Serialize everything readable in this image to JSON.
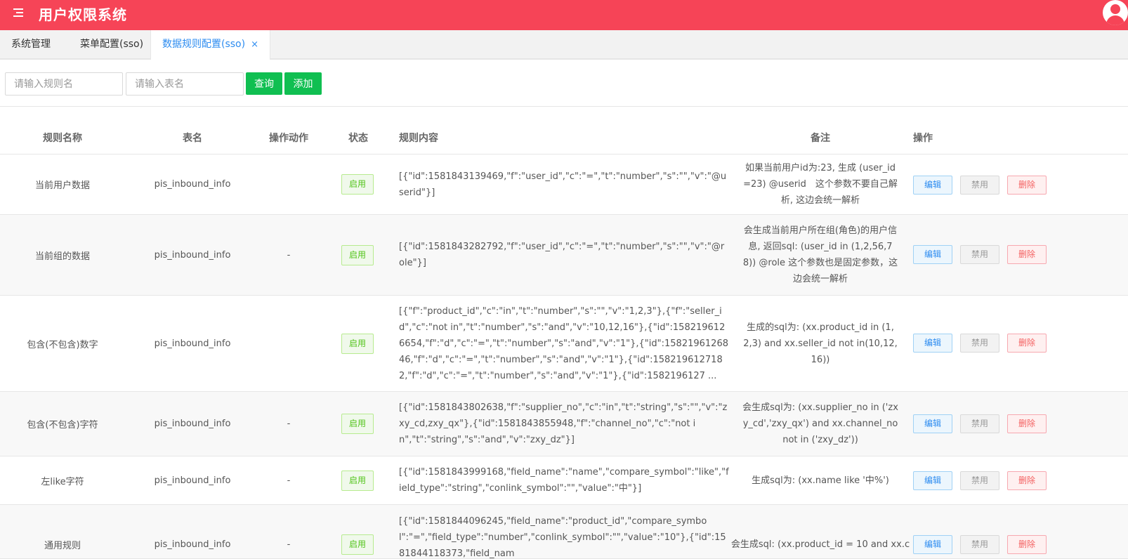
{
  "header": {
    "title": "用户权限系统"
  },
  "tabs": [
    {
      "label": "系统管理"
    },
    {
      "label": "菜单配置(sso)"
    },
    {
      "label": "数据规则配置(sso)",
      "close": "×"
    }
  ],
  "search": {
    "rule_placeholder": "请输入规则名",
    "table_placeholder": "请输入表名",
    "query_label": "查询",
    "add_label": "添加"
  },
  "table": {
    "headers": [
      "规则名称",
      "表名",
      "操作动作",
      "状态",
      "规则内容",
      "备注",
      "操作"
    ],
    "actions": {
      "edit": "编辑",
      "disable": "禁用",
      "delete": "删除"
    },
    "rows": [
      {
        "name": "当前用户数据",
        "table": "pis_inbound_info",
        "action": "",
        "status": "启用",
        "content": "[{\"id\":1581843139469,\"f\":\"user_id\",\"c\":\"=\",\"t\":\"number\",\"s\":\"\",\"v\":\"@userid\"}]",
        "remark": "如果当前用户id为:23, 生成 (user_id=23) @userid　这个参数不要自己解析, 这边会统一解析"
      },
      {
        "name": "当前组的数据",
        "table": "pis_inbound_info",
        "action": "-",
        "status": "启用",
        "content": "[{\"id\":1581843282792,\"f\":\"user_id\",\"c\":\"=\",\"t\":\"number\",\"s\":\"\",\"v\":\"@role\"}]",
        "remark": "会生成当前用户所在组(角色)的用户信息, 返回sql: (user_id in (1,2,56,78)) @role 这个参数也是固定参数，这边会统一解析"
      },
      {
        "name": "包含(不包含)数字",
        "table": "pis_inbound_info",
        "action": "",
        "status": "启用",
        "content": "[{\"f\":\"product_id\",\"c\":\"in\",\"t\":\"number\",\"s\":\"\",\"v\":\"1,2,3\"},{\"f\":\"seller_id\",\"c\":\"not in\",\"t\":\"number\",\"s\":\"and\",\"v\":\"10,12,16\"},{\"id\":1582196126654,\"f\":\"d\",\"c\":\"=\",\"t\":\"number\",\"s\":\"and\",\"v\":\"1\"},{\"id\":1582196126846,\"f\":\"d\",\"c\":\"=\",\"t\":\"number\",\"s\":\"and\",\"v\":\"1\"},{\"id\":1582196127182,\"f\":\"d\",\"c\":\"=\",\"t\":\"number\",\"s\":\"and\",\"v\":\"1\"},{\"id\":1582196127 ...",
        "remark": "生成的sql为: (xx.product_id in (1,2,3) and xx.seller_id not in(10,12,16))"
      },
      {
        "name": "包含(不包含)字符",
        "table": "pis_inbound_info",
        "action": "-",
        "status": "启用",
        "content": "[{\"id\":1581843802638,\"f\":\"supplier_no\",\"c\":\"in\",\"t\":\"string\",\"s\":\"\",\"v\":\"zxy_cd,zxy_qx\"},{\"id\":1581843855948,\"f\":\"channel_no\",\"c\":\"not in\",\"t\":\"string\",\"s\":\"and\",\"v\":\"zxy_dz\"}]",
        "remark": "会生成sql为: (xx.supplier_no in ('zxy_cd','zxy_qx') and xx.channel_no not in ('zxy_dz'))"
      },
      {
        "name": "左like字符",
        "table": "pis_inbound_info",
        "action": "-",
        "status": "启用",
        "content": "[{\"id\":1581843999168,\"field_name\":\"name\",\"compare_symbol\":\"like\",\"field_type\":\"string\",\"conlink_symbol\":\"\",\"value\":\"中\"}]",
        "remark": "生成sql为: (xx.name like '中%')"
      },
      {
        "name": "通用规则",
        "table": "pis_inbound_info",
        "action": "-",
        "status": "启用",
        "content": "[{\"id\":1581844096245,\"field_name\":\"product_id\",\"compare_symbol\":\"=\",\"field_type\":\"number\",\"conlink_symbol\":\"\",\"value\":\"10\"},{\"id\":1581844118373,\"field_nam",
        "remark": "会生成sql: (xx.product_id = 10 and xx.c"
      }
    ]
  }
}
